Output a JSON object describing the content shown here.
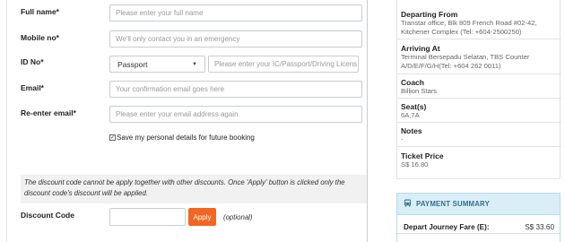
{
  "form": {
    "full_name": {
      "label": "Full name*",
      "placeholder": "Please enter your full name"
    },
    "mobile": {
      "label": "Mobile no*",
      "placeholder": "We'll only contact you in an emergency"
    },
    "id_no": {
      "label": "ID No*",
      "type_value": "Passport",
      "placeholder": "Please enter your IC/Passport/Driving Licens"
    },
    "email": {
      "label": "Email*",
      "placeholder": "Your confirmation email goes here"
    },
    "reenter_email": {
      "label": "Re-enter email*",
      "placeholder": "Please enter your email address again"
    },
    "save_details": {
      "label": "Save my personal details for future booking",
      "checked": true,
      "check_glyph": "✓"
    }
  },
  "discount": {
    "notice": "The discount code cannot be apply together with other discounts. Once 'Apply' button is clicked only the discount code's discount will be applied.",
    "label": "Discount Code",
    "apply_label": "Apply",
    "optional_label": "(optional)"
  },
  "summary": {
    "departing": {
      "title": "Departing From",
      "lines": [
        "Transtar office, Blk 809 French Road #02-42,",
        "Kitchener Complex (Tel: +604-2500250)"
      ]
    },
    "arriving": {
      "title": "Arriving At",
      "lines": [
        "Terminal Bersepadu Selatan, TBS Counter",
        "A/D/E/F/G/H(Tel: +604 262 0011)"
      ]
    },
    "coach": {
      "title": "Coach",
      "value": "Billion Stars"
    },
    "seats": {
      "title": "Seat(s)",
      "value": "6A,7A"
    },
    "notes": {
      "title": "Notes",
      "value": "-"
    },
    "ticket_price": {
      "title": "Ticket Price",
      "value": "S$ 16.80"
    }
  },
  "payment": {
    "title": "PAYMENT SUMMARY",
    "icon": "bus-icon",
    "row_label": "Depart Journey Fare (E):",
    "row_value": "S$ 33.60"
  },
  "colors": {
    "accent": "#f26522",
    "panel_head": "#daeef7",
    "panel_title": "#31708f"
  }
}
